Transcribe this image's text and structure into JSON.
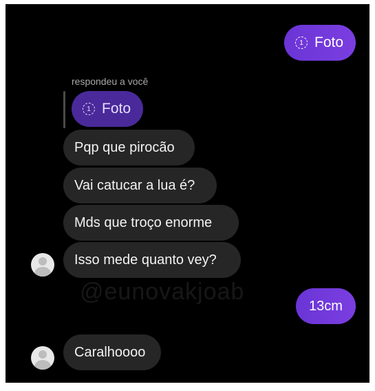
{
  "thread": {
    "sent_photo_1": {
      "label": "Foto",
      "icon": "photo-view-once-icon"
    },
    "reply_note": "respondeu a você",
    "replied_photo": {
      "label": "Foto",
      "icon": "photo-view-once-icon"
    },
    "received_1": "Pqp que pirocão",
    "received_2": "Vai catucar a lua é?",
    "received_3": "Mds que troço enorme",
    "received_4": "Isso mede quanto vey?",
    "sent_2": "13cm",
    "received_5": "Caralhoooo",
    "watermark": "@eunovakjoab",
    "photo_icon_glyph": "1"
  },
  "colors": {
    "background": "#000000",
    "sent_bubble": "#6f3ad8",
    "received_bubble": "#262626",
    "replied_bubble": "#4a2a9a"
  }
}
